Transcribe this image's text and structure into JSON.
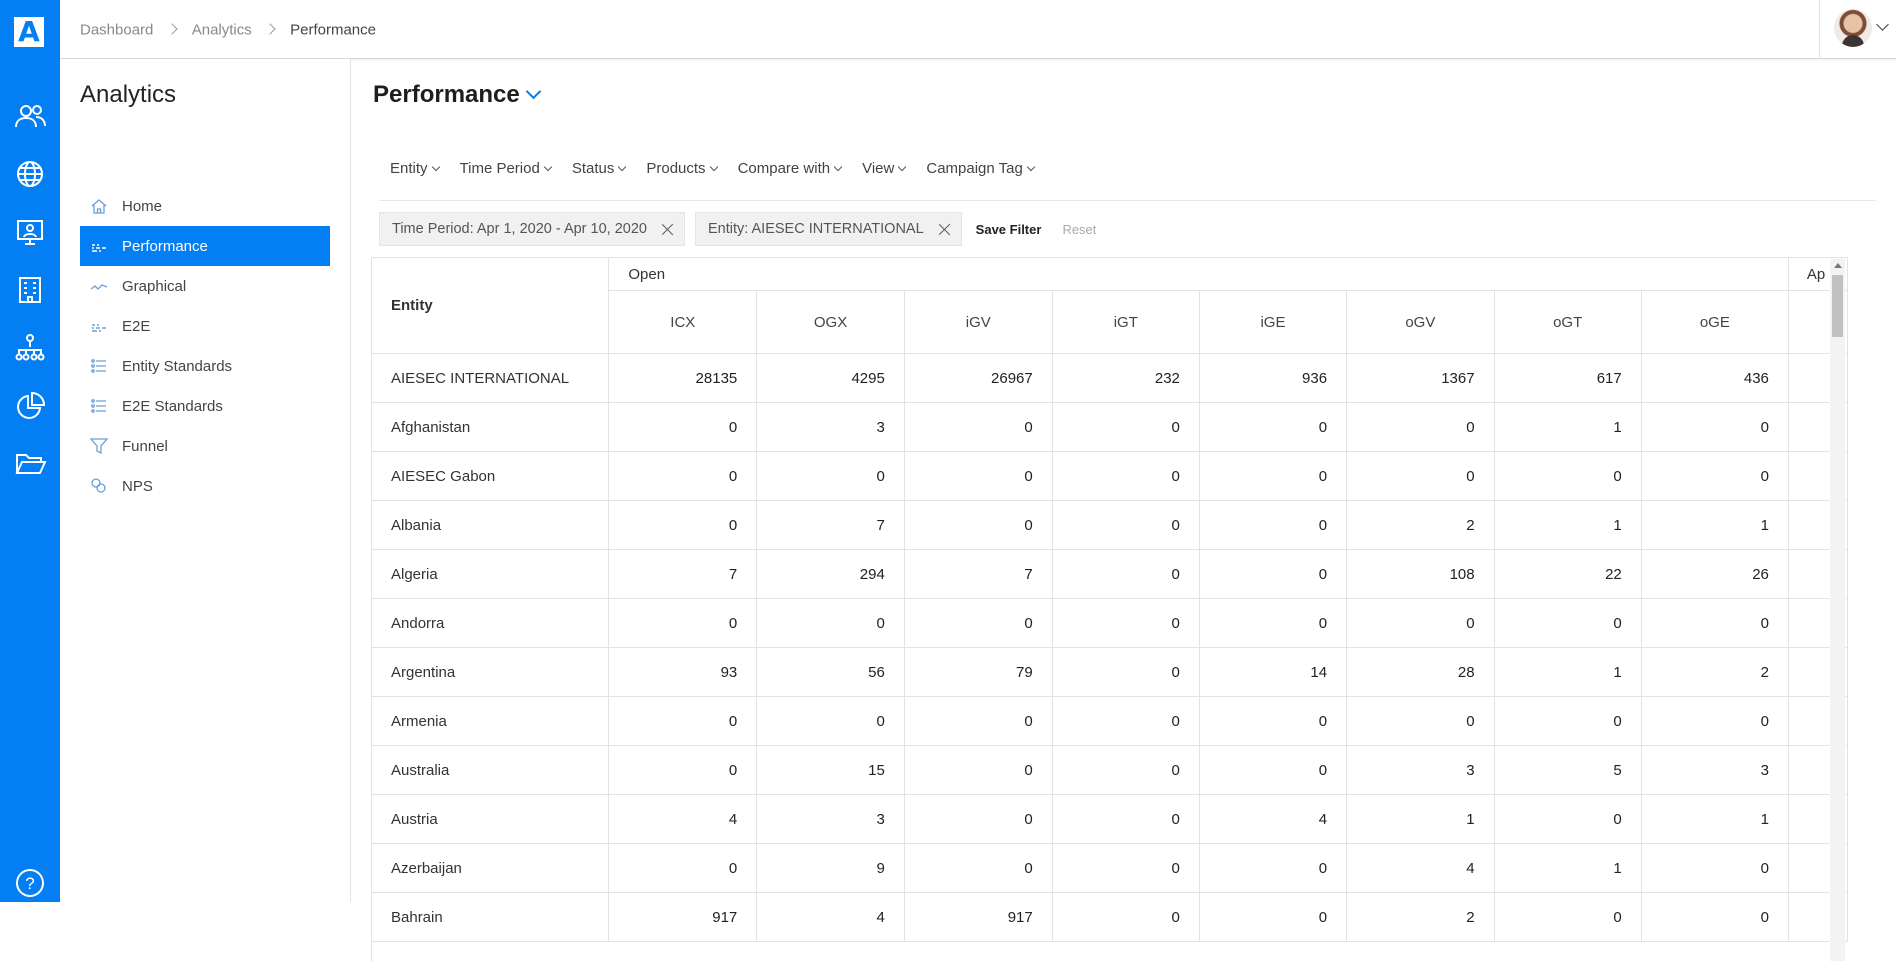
{
  "rail": {
    "logo": "A",
    "icons": [
      "people-icon",
      "globe-icon",
      "portrait-icon",
      "building-icon",
      "org-chart-icon",
      "pie-chart-icon",
      "folder-open-icon",
      "help-icon"
    ],
    "help_label": "?",
    "accent": "#037ef3"
  },
  "breadcrumb": [
    "Dashboard",
    "Analytics",
    "Performance"
  ],
  "sidebar": {
    "title": "Analytics",
    "items": [
      {
        "label": "Home",
        "icon": "home-icon"
      },
      {
        "label": "Performance",
        "icon": "performance-icon",
        "active": true
      },
      {
        "label": "Graphical",
        "icon": "line-graph-icon"
      },
      {
        "label": "E2E",
        "icon": "e2e-icon"
      },
      {
        "label": "Entity Standards",
        "icon": "list-icon"
      },
      {
        "label": "E2E Standards",
        "icon": "list-icon"
      },
      {
        "label": "Funnel",
        "icon": "funnel-icon"
      },
      {
        "label": "NPS",
        "icon": "nps-icon"
      }
    ]
  },
  "main": {
    "title": "Performance",
    "filters": [
      "Entity",
      "Time Period",
      "Status",
      "Products",
      "Compare with",
      "View",
      "Campaign Tag"
    ],
    "chips": [
      "Time Period: Apr 1, 2020 - Apr 10, 2020",
      "Entity: AIESEC INTERNATIONAL"
    ],
    "save_filter": "Save Filter",
    "reset": "Reset"
  },
  "table": {
    "entity_header": "Entity",
    "group_header": "Open",
    "next_group_header": "Ap",
    "columns": [
      "ICX",
      "OGX",
      "iGV",
      "iGT",
      "iGE",
      "oGV",
      "oGT",
      "oGE"
    ],
    "rows": [
      {
        "entity": "AIESEC INTERNATIONAL",
        "values": [
          "28135",
          "4295",
          "26967",
          "232",
          "936",
          "1367",
          "617",
          "436"
        ]
      },
      {
        "entity": "Afghanistan",
        "values": [
          "0",
          "3",
          "0",
          "0",
          "0",
          "0",
          "1",
          "0"
        ]
      },
      {
        "entity": "AIESEC Gabon",
        "values": [
          "0",
          "0",
          "0",
          "0",
          "0",
          "0",
          "0",
          "0"
        ]
      },
      {
        "entity": "Albania",
        "values": [
          "0",
          "7",
          "0",
          "0",
          "0",
          "2",
          "1",
          "1"
        ]
      },
      {
        "entity": "Algeria",
        "values": [
          "7",
          "294",
          "7",
          "0",
          "0",
          "108",
          "22",
          "26"
        ]
      },
      {
        "entity": "Andorra",
        "values": [
          "0",
          "0",
          "0",
          "0",
          "0",
          "0",
          "0",
          "0"
        ]
      },
      {
        "entity": "Argentina",
        "values": [
          "93",
          "56",
          "79",
          "0",
          "14",
          "28",
          "1",
          "2"
        ]
      },
      {
        "entity": "Armenia",
        "values": [
          "0",
          "0",
          "0",
          "0",
          "0",
          "0",
          "0",
          "0"
        ]
      },
      {
        "entity": "Australia",
        "values": [
          "0",
          "15",
          "0",
          "0",
          "0",
          "3",
          "5",
          "3"
        ]
      },
      {
        "entity": "Austria",
        "values": [
          "4",
          "3",
          "0",
          "0",
          "4",
          "1",
          "0",
          "1"
        ]
      },
      {
        "entity": "Azerbaijan",
        "values": [
          "0",
          "9",
          "0",
          "0",
          "0",
          "4",
          "1",
          "0"
        ]
      },
      {
        "entity": "Bahrain",
        "values": [
          "917",
          "4",
          "917",
          "0",
          "0",
          "2",
          "0",
          "0"
        ]
      }
    ]
  }
}
